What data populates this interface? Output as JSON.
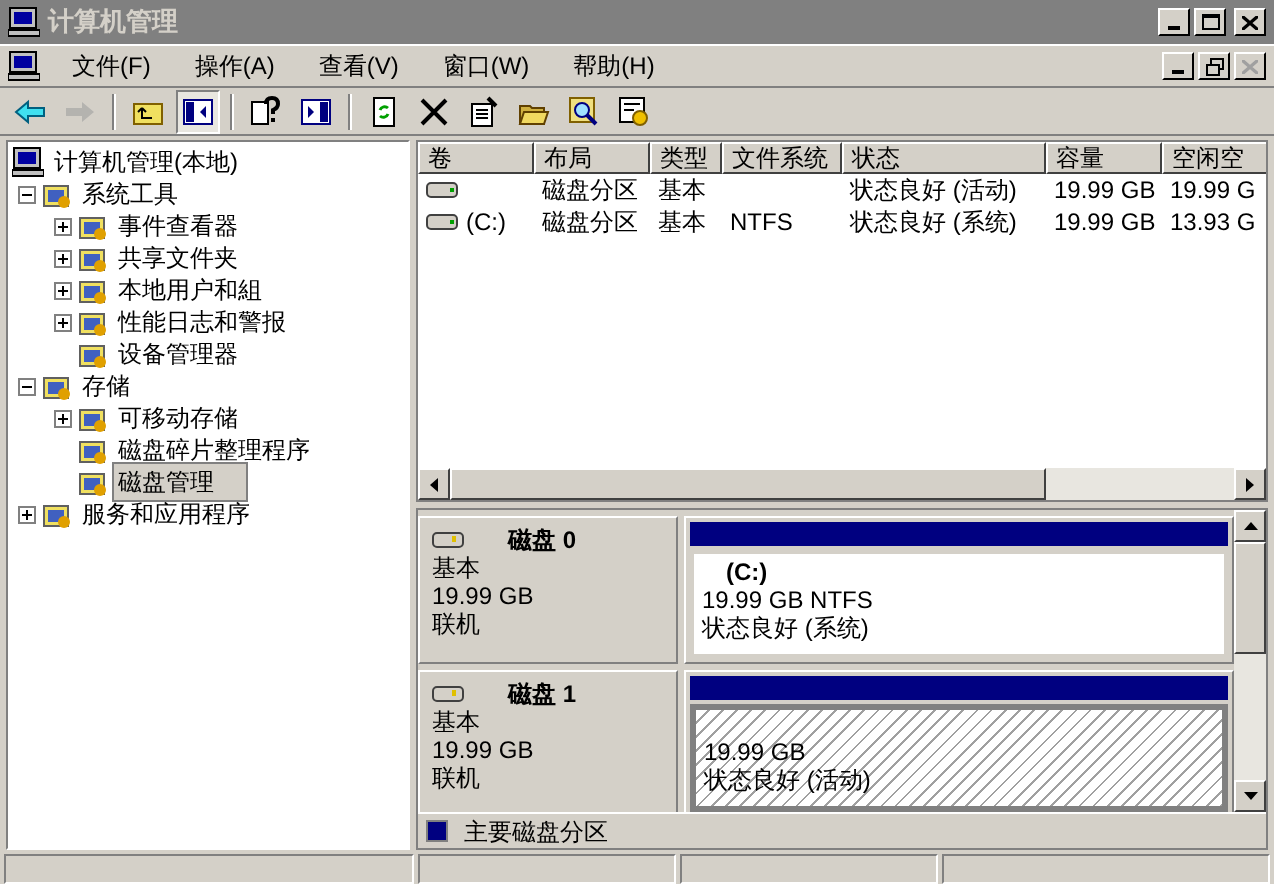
{
  "window": {
    "title": "计算机管理"
  },
  "menu": [
    "文件(F)",
    "操作(A)",
    "查看(V)",
    "窗口(W)",
    "帮助(H)"
  ],
  "toolbar": [
    {
      "kind": "back",
      "disabled": false
    },
    {
      "kind": "forward",
      "disabled": true
    },
    {
      "kind": "separator"
    },
    {
      "kind": "up",
      "disabled": false
    },
    {
      "kind": "tree",
      "disabled": false,
      "pressed": true
    },
    {
      "kind": "separator"
    },
    {
      "kind": "help",
      "disabled": false
    },
    {
      "kind": "panel",
      "disabled": false
    },
    {
      "kind": "separator"
    },
    {
      "kind": "refresh",
      "disabled": false
    },
    {
      "kind": "delete",
      "disabled": false
    },
    {
      "kind": "properties",
      "disabled": false
    },
    {
      "kind": "open",
      "disabled": false
    },
    {
      "kind": "search",
      "disabled": false
    },
    {
      "kind": "settings",
      "disabled": false
    }
  ],
  "tree": [
    {
      "label": "计算机管理(本地)",
      "selected": false,
      "children": [
        {
          "label": "系统工具",
          "expanded": true,
          "selected": false,
          "children": [
            {
              "label": "事件查看器",
              "expanded": false,
              "selected": false
            },
            {
              "label": "共享文件夹",
              "expanded": false,
              "selected": false
            },
            {
              "label": "本地用户和組",
              "expanded": false,
              "selected": false
            },
            {
              "label": "性能日志和警报",
              "expanded": false,
              "selected": false
            },
            {
              "label": "设备管理器",
              "selected": false
            }
          ]
        },
        {
          "label": "存储",
          "expanded": true,
          "selected": false,
          "children": [
            {
              "label": "可移动存储",
              "expanded": false,
              "selected": false
            },
            {
              "label": "磁盘碎片整理程序",
              "selected": false
            },
            {
              "label": "磁盘管理",
              "selected": true
            }
          ]
        },
        {
          "label": "服务和应用程序",
          "expanded": false,
          "selected": false
        }
      ]
    }
  ],
  "table": {
    "columns": [
      "卷",
      "布局",
      "类型",
      "文件系统",
      "状态",
      "容量",
      "空闲空"
    ],
    "rows": [
      {
        "cells": [
          "",
          "磁盘分区",
          "基本",
          "",
          "状态良好 (活动)",
          "19.99 GB",
          "19.99 G"
        ]
      },
      {
        "cells": [
          "(C:)",
          "磁盘分区",
          "基本",
          "NTFS",
          "状态良好 (系统)",
          "19.99 GB",
          "13.93 G"
        ]
      }
    ]
  },
  "disks": [
    {
      "name": "磁盘 0",
      "type": "基本",
      "size": "19.99 GB",
      "status": "联机",
      "partitions": [
        {
          "label": "(C:)",
          "size": "19.99 GB NTFS",
          "status": "状态良好 (系统)",
          "selected": false
        }
      ]
    },
    {
      "name": "磁盘 1",
      "type": "基本",
      "size": "19.99 GB",
      "status": "联机",
      "partitions": [
        {
          "size": "19.99 GB",
          "status": "状态良好 (活动)",
          "selected": true
        }
      ]
    }
  ],
  "legend": [
    {
      "label": "主要磁盘分区",
      "color": "#000080"
    }
  ]
}
